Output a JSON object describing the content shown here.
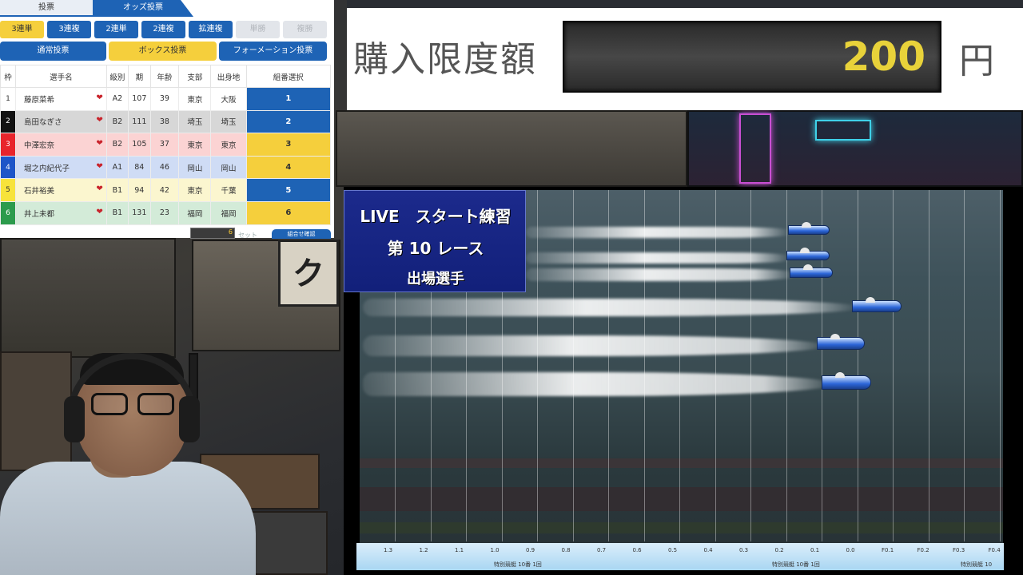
{
  "bet_panel": {
    "tabs": [
      "投票",
      "オッズ投票"
    ],
    "bet_types": [
      {
        "label": "3連単",
        "state": "active"
      },
      {
        "label": "3連複",
        "state": "normal"
      },
      {
        "label": "2連単",
        "state": "normal"
      },
      {
        "label": "2連複",
        "state": "normal"
      },
      {
        "label": "拡連複",
        "state": "normal"
      },
      {
        "label": "単勝",
        "state": "disabled"
      },
      {
        "label": "複勝",
        "state": "disabled"
      }
    ],
    "modes": [
      {
        "label": "通常投票",
        "state": "normal"
      },
      {
        "label": "ボックス投票",
        "state": "active"
      },
      {
        "label": "フォーメーション投票",
        "state": "normal"
      }
    ],
    "columns": [
      "枠",
      "選手名",
      "級別",
      "期",
      "年齢",
      "支部",
      "出身地",
      "組番選択"
    ],
    "racers": [
      {
        "frame": "1",
        "name": "藤原菜希",
        "class": "A2",
        "term": "107",
        "age": "39",
        "branch": "東京",
        "origin": "大阪",
        "select": "1",
        "frame_color": "#ffffff",
        "frame_text": "#333333",
        "row_color": "#ffffff",
        "select_color": "#1e63b5"
      },
      {
        "frame": "2",
        "name": "島田なぎさ",
        "class": "B2",
        "term": "111",
        "age": "38",
        "branch": "埼玉",
        "origin": "埼玉",
        "select": "2",
        "frame_color": "#111111",
        "frame_text": "#ffffff",
        "row_color": "#d7d7d7",
        "select_color": "#1e63b5"
      },
      {
        "frame": "3",
        "name": "中澤宏奈",
        "class": "B2",
        "term": "105",
        "age": "37",
        "branch": "東京",
        "origin": "東京",
        "select": "3",
        "frame_color": "#e8242b",
        "frame_text": "#ffffff",
        "row_color": "#fbd3d3",
        "select_color": "#f5cf3c"
      },
      {
        "frame": "4",
        "name": "堀之内紀代子",
        "class": "A1",
        "term": "84",
        "age": "46",
        "branch": "岡山",
        "origin": "岡山",
        "select": "4",
        "frame_color": "#1e55c8",
        "frame_text": "#ffffff",
        "row_color": "#cfdcf5",
        "select_color": "#f5cf3c"
      },
      {
        "frame": "5",
        "name": "石井裕美",
        "class": "B1",
        "term": "94",
        "age": "42",
        "branch": "東京",
        "origin": "千葉",
        "select": "5",
        "frame_color": "#f7e33a",
        "frame_text": "#333333",
        "row_color": "#fbf6cf",
        "select_color": "#1e63b5"
      },
      {
        "frame": "6",
        "name": "井上未都",
        "class": "B1",
        "term": "131",
        "age": "23",
        "branch": "福岡",
        "origin": "福岡",
        "select": "6",
        "frame_color": "#2c9b4c",
        "frame_text": "#ffffff",
        "row_color": "#d3ebd8",
        "select_color": "#f5cf3c"
      }
    ],
    "bottom_count": "6",
    "bottom_unit": "セット",
    "combo_button": "組合せ確認"
  },
  "limit": {
    "label": "購入限度額",
    "value": "200",
    "unit": "円"
  },
  "live": {
    "line1": "LIVE　スタート練習",
    "line2": "第 10 レース",
    "line3": "出場選手",
    "ticks": [
      "1.3",
      "1.2",
      "1.1",
      "1.0",
      "0.9",
      "0.8",
      "0.7",
      "0.6",
      "0.5",
      "0.4",
      "0.3",
      "0.2",
      "0.1",
      "0.0",
      "F0.1",
      "F0.2",
      "F0.3",
      "F0.4"
    ],
    "strip_left": "特別競艇 10番 1回",
    "strip_mid": "特別競艇 10番 1回",
    "strip_right": "特別競艇 10"
  },
  "colors": {
    "accent_blue": "#1e63b5",
    "accent_yellow": "#f5cf3c",
    "limit_value": "#e8d23a"
  }
}
